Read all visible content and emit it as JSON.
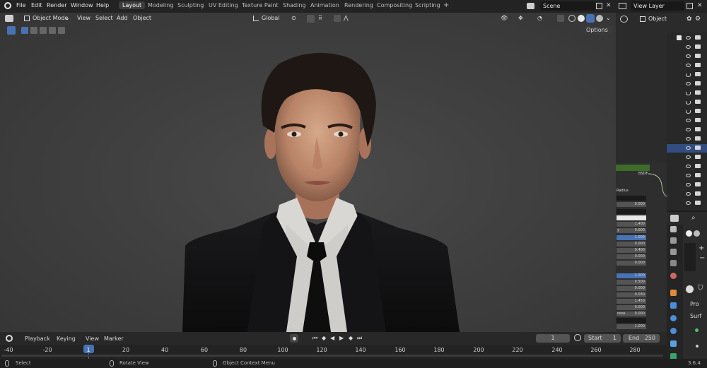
{
  "menu": [
    "File",
    "Edit",
    "Render",
    "Window",
    "Help"
  ],
  "workspaces": [
    "Layout",
    "Modeling",
    "Sculpting",
    "UV Editing",
    "Texture Paint",
    "Shading",
    "Animation",
    "Rendering",
    "Compositing",
    "Scripting"
  ],
  "add_workspace": "+",
  "scene": {
    "name": "Scene"
  },
  "view_layer": {
    "name": "View Layer"
  },
  "viewport_header": {
    "mode": "Object Mode",
    "view": "View",
    "select": "Select",
    "add": "Add",
    "object": "Object",
    "orientation": "Global",
    "options": "Options"
  },
  "properties_header": {
    "object": "Object"
  },
  "node_strip": {
    "bsdf": "BSDF",
    "radius": "Radius",
    "values": [
      "0.000",
      "1.400",
      "0.000",
      "1.000",
      "0.000",
      "0.400",
      "0.000",
      "0.000",
      "1.000",
      "0.500",
      "0.000",
      "0.030",
      "1.450",
      "0.000",
      "0.000",
      "1.000"
    ],
    "partial_labels": [
      "y",
      "ness"
    ]
  },
  "properties_panel": {
    "pro": "Pro",
    "surf": "Surf"
  },
  "timeline": {
    "playback": "Playback",
    "keying": "Keying",
    "view": "View",
    "marker": "Marker",
    "current_frame": "1",
    "start_label": "Start",
    "start": "1",
    "end_label": "End",
    "end": "250",
    "ticks": [
      "-40",
      "-20",
      "1",
      "20",
      "40",
      "60",
      "80",
      "100",
      "120",
      "140",
      "160",
      "180",
      "200",
      "220",
      "240",
      "260",
      "280"
    ]
  },
  "status": {
    "select": "Select",
    "rotate": "Rotate View",
    "context_menu": "Object Context Menu",
    "version": "3.6.4"
  },
  "colors": {
    "accent": "#4772b3",
    "active_frame": "#4772b3",
    "node_header": "#3d6b2a"
  }
}
